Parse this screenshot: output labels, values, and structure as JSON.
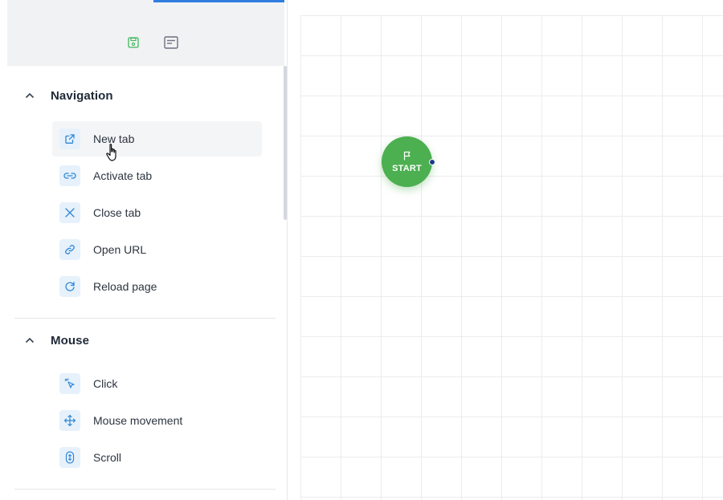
{
  "toolbar": {
    "save_icon": "save-icon",
    "notes_icon": "notes-icon",
    "save_color": "#3fb75c",
    "notes_color": "#6b7280"
  },
  "sections": [
    {
      "title": "Navigation",
      "expanded": true,
      "items": [
        {
          "label": "New tab",
          "icon": "external-link-icon"
        },
        {
          "label": "Activate tab",
          "icon": "link-icon"
        },
        {
          "label": "Close tab",
          "icon": "close-icon"
        },
        {
          "label": "Open URL",
          "icon": "chain-link-icon"
        },
        {
          "label": "Reload page",
          "icon": "reload-icon"
        }
      ]
    },
    {
      "title": "Mouse",
      "expanded": true,
      "items": [
        {
          "label": "Click",
          "icon": "click-cursor-icon"
        },
        {
          "label": "Mouse movement",
          "icon": "move-arrows-icon"
        },
        {
          "label": "Scroll",
          "icon": "scroll-mouse-icon"
        }
      ]
    }
  ],
  "canvas": {
    "start_node": {
      "label": "START",
      "icon": "flag-icon",
      "color": "#4caf50"
    }
  },
  "accent": "#2f7de1",
  "icon_color": "#2f87d6"
}
